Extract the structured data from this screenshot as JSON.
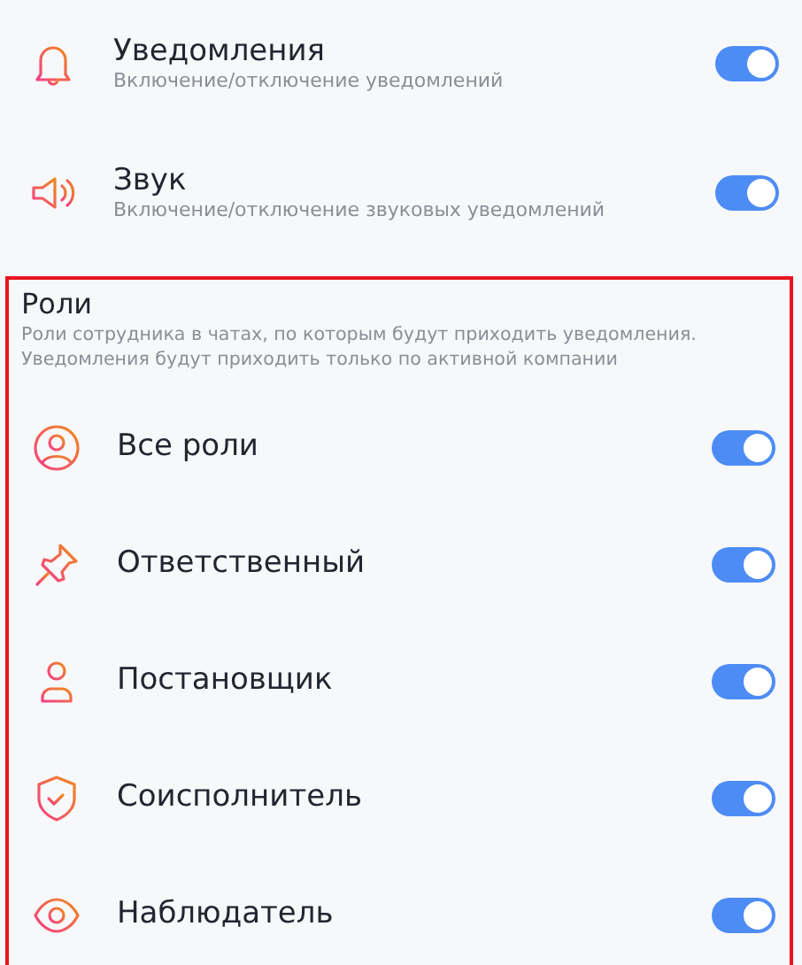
{
  "settings": [
    {
      "kind": "bell",
      "title": "Уведомления",
      "subtitle": "Включение/отключение уведомлений",
      "on": true
    },
    {
      "kind": "sound",
      "title": "Звук",
      "subtitle": "Включение/отключение звуковых уведомлений",
      "on": true
    }
  ],
  "roles": {
    "title": "Роли",
    "highlighted": true,
    "description": "Роли сотрудника в чатах, по которым будут приходить уведомления. Уведомления будут приходить только по активной компании",
    "items": [
      {
        "kind": "user-circle",
        "label": "Все роли",
        "on": true
      },
      {
        "kind": "pin",
        "label": "Ответственный",
        "on": true
      },
      {
        "kind": "user",
        "label": "Постановщик",
        "on": true
      },
      {
        "kind": "shield",
        "label": "Соисполнитель",
        "on": true
      },
      {
        "kind": "eye",
        "label": "Наблюдатель",
        "on": true
      }
    ]
  }
}
